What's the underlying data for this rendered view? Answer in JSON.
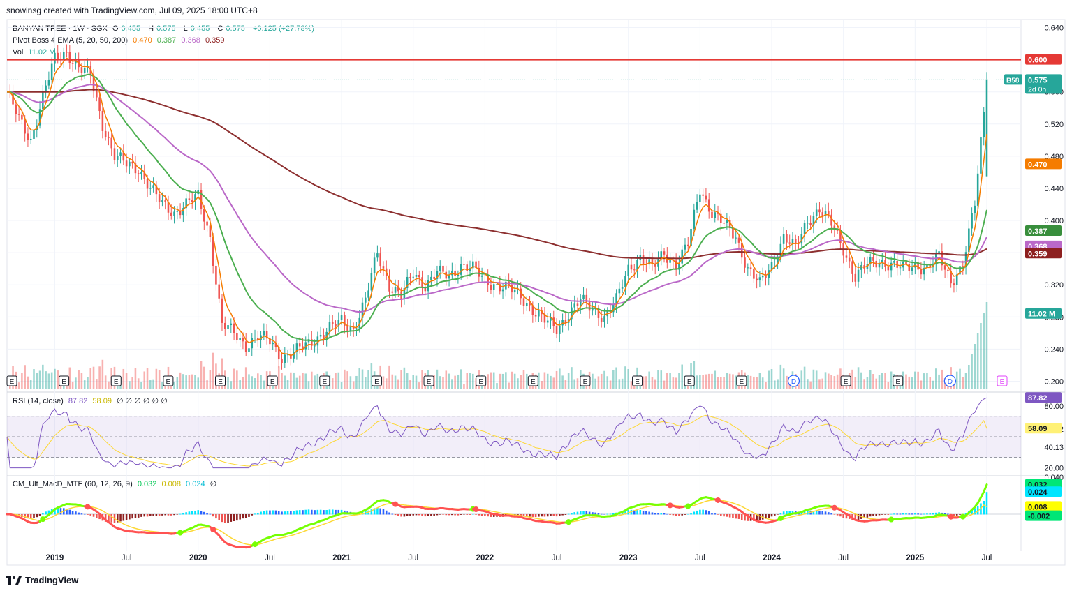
{
  "header": {
    "created": "snowinsg created with TradingView.com, Jul 09, 2025 18:00 UTC+8"
  },
  "colors": {
    "up": "#26a69a",
    "down": "#ef5350",
    "ema5": "#f57c00",
    "ema20": "#4caf50",
    "ema50": "#ba68c8",
    "ema200": "#8d2f2f",
    "resistance": "#e53935"
  },
  "legend_main": {
    "title": "BANYAN TREE · 1W · SGX",
    "o_label": "O",
    "o": "0.455",
    "h_label": "H",
    "h": "0.575",
    "l_label": "L",
    "l": "0.455",
    "c_label": "C",
    "c": "0.575",
    "change": "+0.125 (+27.78%)"
  },
  "legend_ema": {
    "title": "Pivot Boss 4 EMA (5, 20, 50, 200)",
    "v1": "0.470",
    "v2": "0.387",
    "v3": "0.368",
    "v4": "0.359"
  },
  "legend_vol": {
    "title": "Vol",
    "value": "11.02 M"
  },
  "legend_rsi": {
    "title": "RSI (14, close)",
    "v1": "87.82",
    "v2": "58.09",
    "rest": "∅ ∅ ∅ ∅ ∅ ∅"
  },
  "legend_macd": {
    "title": "CM_Ult_MacD_MTF (60, 12, 26, 9)",
    "v1": "0.032",
    "v2": "0.008",
    "v3": "0.024",
    "rest": "∅"
  },
  "brand": "TradingView",
  "chart_data": [
    {
      "type": "candlestick",
      "title": "BANYAN TREE · 1W · SGX",
      "x_ticks": [
        "2019",
        "Jul",
        "2020",
        "Jul",
        "2021",
        "Jul",
        "2022",
        "Jul",
        "2023",
        "Jul",
        "2024",
        "Jul",
        "2025",
        "Jul"
      ],
      "y_ticks": [
        0.64,
        0.6,
        0.56,
        0.52,
        0.48,
        0.44,
        0.4,
        0.36,
        0.32,
        0.28,
        0.24,
        0.2
      ],
      "y_tick_labels": [
        "0.640",
        "0.560",
        "0.520",
        "0.480",
        "0.440",
        "0.400",
        "0.320",
        "0.280",
        "0.240",
        "0.200"
      ],
      "ylim": [
        0.19,
        0.65
      ],
      "close_series": [
        [
          "2018-09",
          0.56
        ],
        [
          "2018-10",
          0.525
        ],
        [
          "2018-11",
          0.5
        ],
        [
          "2018-12",
          0.555
        ],
        [
          "2019-01",
          0.6
        ],
        [
          "2019-02",
          0.61
        ],
        [
          "2019-03",
          0.59
        ],
        [
          "2019-04",
          0.58
        ],
        [
          "2019-05",
          0.52
        ],
        [
          "2019-06",
          0.48
        ],
        [
          "2019-07",
          0.47
        ],
        [
          "2019-08",
          0.465
        ],
        [
          "2019-09",
          0.44
        ],
        [
          "2019-10",
          0.42
        ],
        [
          "2019-11",
          0.41
        ],
        [
          "2019-12",
          0.42
        ],
        [
          "2020-01",
          0.43
        ],
        [
          "2020-02",
          0.38
        ],
        [
          "2020-03",
          0.27
        ],
        [
          "2020-04",
          0.26
        ],
        [
          "2020-05",
          0.245
        ],
        [
          "2020-06",
          0.255
        ],
        [
          "2020-07",
          0.25
        ],
        [
          "2020-08",
          0.23
        ],
        [
          "2020-09",
          0.235
        ],
        [
          "2020-10",
          0.245
        ],
        [
          "2020-11",
          0.255
        ],
        [
          "2020-12",
          0.265
        ],
        [
          "2021-01",
          0.275
        ],
        [
          "2021-02",
          0.265
        ],
        [
          "2021-03",
          0.3
        ],
        [
          "2021-04",
          0.36
        ],
        [
          "2021-05",
          0.32
        ],
        [
          "2021-06",
          0.305
        ],
        [
          "2021-07",
          0.335
        ],
        [
          "2021-08",
          0.32
        ],
        [
          "2021-09",
          0.335
        ],
        [
          "2021-10",
          0.33
        ],
        [
          "2021-11",
          0.345
        ],
        [
          "2021-12",
          0.34
        ],
        [
          "2022-01",
          0.325
        ],
        [
          "2022-02",
          0.32
        ],
        [
          "2022-03",
          0.315
        ],
        [
          "2022-04",
          0.305
        ],
        [
          "2022-05",
          0.29
        ],
        [
          "2022-06",
          0.275
        ],
        [
          "2022-07",
          0.265
        ],
        [
          "2022-08",
          0.285
        ],
        [
          "2022-09",
          0.3
        ],
        [
          "2022-10",
          0.29
        ],
        [
          "2022-11",
          0.28
        ],
        [
          "2022-12",
          0.3
        ],
        [
          "2023-01",
          0.34
        ],
        [
          "2023-02",
          0.355
        ],
        [
          "2023-03",
          0.34
        ],
        [
          "2023-04",
          0.36
        ],
        [
          "2023-05",
          0.345
        ],
        [
          "2023-06",
          0.37
        ],
        [
          "2023-07",
          0.44
        ],
        [
          "2023-08",
          0.41
        ],
        [
          "2023-09",
          0.395
        ],
        [
          "2023-10",
          0.38
        ],
        [
          "2023-11",
          0.34
        ],
        [
          "2023-12",
          0.32
        ],
        [
          "2024-01",
          0.345
        ],
        [
          "2024-02",
          0.38
        ],
        [
          "2024-03",
          0.365
        ],
        [
          "2024-04",
          0.4
        ],
        [
          "2024-05",
          0.415
        ],
        [
          "2024-06",
          0.395
        ],
        [
          "2024-07",
          0.365
        ],
        [
          "2024-08",
          0.33
        ],
        [
          "2024-09",
          0.345
        ],
        [
          "2024-10",
          0.35
        ],
        [
          "2024-11",
          0.345
        ],
        [
          "2024-12",
          0.34
        ],
        [
          "2025-01",
          0.345
        ],
        [
          "2025-02",
          0.34
        ],
        [
          "2025-03",
          0.355
        ],
        [
          "2025-04",
          0.325
        ],
        [
          "2025-05",
          0.345
        ],
        [
          "2025-06",
          0.42
        ],
        [
          "2025-07",
          0.575
        ]
      ],
      "last": {
        "open": 0.455,
        "high": 0.575,
        "low": 0.455,
        "close": 0.575
      },
      "resistance_line": 0.6,
      "price_labels": [
        {
          "text": "0.600",
          "value": 0.6,
          "color": "#e53935"
        },
        {
          "text": "0.575",
          "value": 0.575,
          "color": "#26a69a",
          "sub": "2d 0h",
          "tag": "B58"
        },
        {
          "text": "0.470",
          "value": 0.47,
          "color": "#f57c00"
        },
        {
          "text": "0.387",
          "value": 0.387,
          "color": "#388e3c"
        },
        {
          "text": "0.368",
          "value": 0.368,
          "color": "#ba68c8"
        },
        {
          "text": "0.359",
          "value": 0.359,
          "color": "#8d1f1f"
        },
        {
          "text": "11.02 M",
          "value": 0.284,
          "color": "#26a69a"
        }
      ],
      "event_markers": [
        "E",
        "E",
        "E",
        "E",
        "E",
        "E",
        "E",
        "E",
        "E",
        "E",
        "E",
        "E",
        "E",
        "E",
        "E",
        "D",
        "E",
        "E",
        "D",
        "E"
      ]
    },
    {
      "type": "line",
      "title": "RSI (14, close)",
      "y_ticks": [
        80.0,
        57.52,
        40.13,
        20.0
      ],
      "y_tick_labels": [
        "80.00",
        "57.52",
        "40.13",
        "20.00"
      ],
      "band": [
        30,
        70
      ],
      "ylim": [
        15,
        92
      ],
      "last": 87.82,
      "signal_last": 58.09,
      "price_labels": [
        {
          "text": "87.82",
          "value": 87.82,
          "color": "#7e57c2"
        },
        {
          "text": "58.09",
          "value": 58.09,
          "color": "#fff176"
        }
      ]
    },
    {
      "type": "bar",
      "title": "CM_Ult_MacD_MTF (60, 12, 26, 9)",
      "y_ticks": [
        0.04
      ],
      "y_tick_labels": [
        "0.040"
      ],
      "ylim": [
        -0.04,
        0.04
      ],
      "last_macd": 0.032,
      "last_signal": 0.008,
      "last_hist": 0.024,
      "price_labels": [
        {
          "text": "0.032",
          "value": 0.032,
          "color": "#00e676"
        },
        {
          "text": "0.024",
          "value": 0.024,
          "color": "#00e5ff"
        },
        {
          "text": "0.008",
          "value": 0.008,
          "color": "#ffff00"
        },
        {
          "text": "-0.002",
          "value": -0.002,
          "color": "#00e676"
        }
      ]
    }
  ]
}
